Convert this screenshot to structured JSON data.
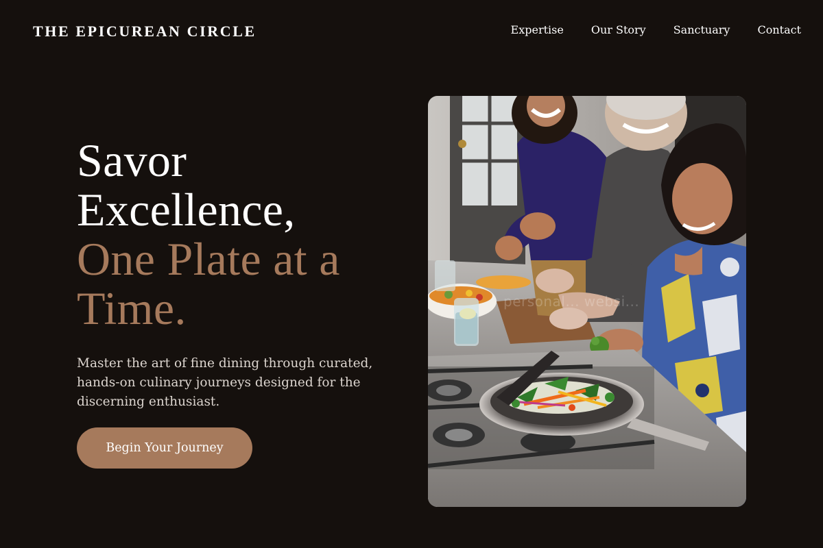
{
  "brand": {
    "name": "THE EPICUREAN CIRCLE"
  },
  "nav": {
    "items": [
      {
        "label": "Expertise"
      },
      {
        "label": "Our Story"
      },
      {
        "label": "Sanctuary"
      },
      {
        "label": "Contact"
      }
    ]
  },
  "hero": {
    "headline_line1": "Savor",
    "headline_line2": "Excellence,",
    "headline_accent_line1": "One Plate at a",
    "headline_accent_line2": "Time.",
    "subtitle": "Master the art of fine dining through curated, hands-on culinary journeys designed for the discerning enthusiast.",
    "cta_label": "Begin Your Journey",
    "image": {
      "description": "Three smiling women cooking together at a stainless kitchen stove with a pan of stir-fried vegetables",
      "watermark": "personal... websi..."
    }
  },
  "colors": {
    "background": "#15100d",
    "accent": "#a67a5c",
    "text": "#ffffff",
    "muted_text": "#ddd6d0"
  }
}
